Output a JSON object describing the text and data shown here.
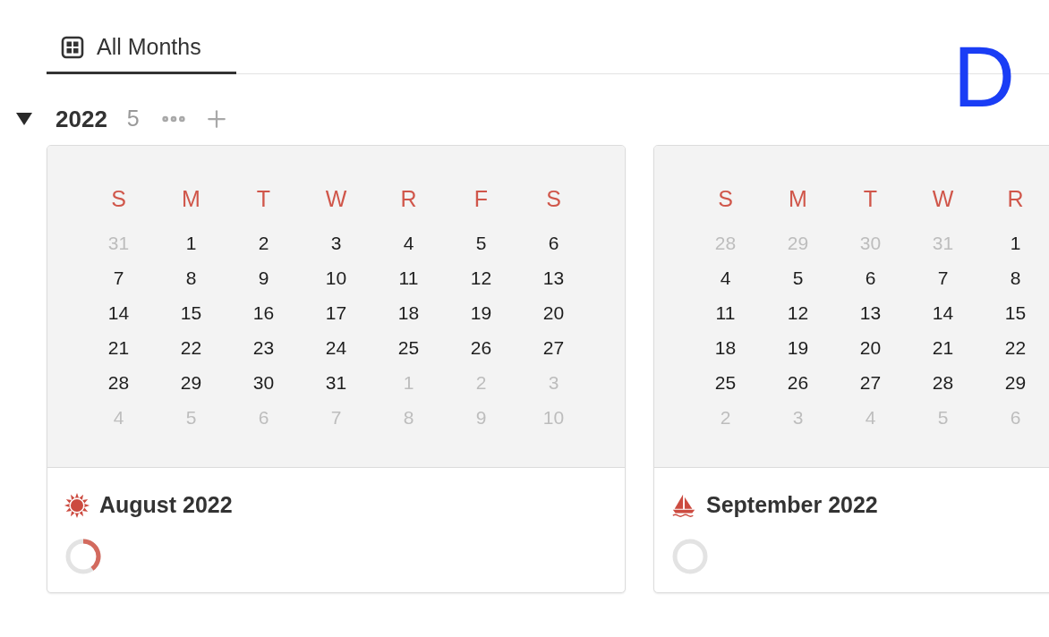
{
  "tabs": [
    {
      "label": "All Months",
      "selected": true
    }
  ],
  "corner_letter": "D",
  "group": {
    "title": "2022",
    "count": "5",
    "expanded": true
  },
  "cards": [
    {
      "title": "August 2022",
      "level": 0.4,
      "weekdays": [
        "S",
        "M",
        "T",
        "W",
        "R",
        "F",
        "S"
      ],
      "weeks": [
        [
          {
            "text": "31",
            "muted": true
          },
          {
            "text": "1",
            "muted": false
          },
          {
            "text": "2",
            "muted": false
          },
          {
            "text": "3",
            "muted": false
          },
          {
            "text": "4",
            "muted": false
          },
          {
            "text": "5",
            "muted": false
          },
          {
            "text": "6",
            "muted": false
          }
        ],
        [
          {
            "text": "7",
            "muted": false
          },
          {
            "text": "8",
            "muted": false
          },
          {
            "text": "9",
            "muted": false
          },
          {
            "text": "10",
            "muted": false
          },
          {
            "text": "11",
            "muted": false
          },
          {
            "text": "12",
            "muted": false
          },
          {
            "text": "13",
            "muted": false
          }
        ],
        [
          {
            "text": "14",
            "muted": false
          },
          {
            "text": "15",
            "muted": false
          },
          {
            "text": "16",
            "muted": false
          },
          {
            "text": "17",
            "muted": false
          },
          {
            "text": "18",
            "muted": false
          },
          {
            "text": "19",
            "muted": false
          },
          {
            "text": "20",
            "muted": false
          }
        ],
        [
          {
            "text": "21",
            "muted": false
          },
          {
            "text": "22",
            "muted": false
          },
          {
            "text": "23",
            "muted": false
          },
          {
            "text": "24",
            "muted": false
          },
          {
            "text": "25",
            "muted": false
          },
          {
            "text": "26",
            "muted": false
          },
          {
            "text": "27",
            "muted": false
          }
        ],
        [
          {
            "text": "28",
            "muted": false
          },
          {
            "text": "29",
            "muted": false
          },
          {
            "text": "30",
            "muted": false
          },
          {
            "text": "31",
            "muted": false
          },
          {
            "text": "1",
            "muted": true
          },
          {
            "text": "2",
            "muted": true
          },
          {
            "text": "3",
            "muted": true
          }
        ],
        [
          {
            "text": "4",
            "muted": true
          },
          {
            "text": "5",
            "muted": true
          },
          {
            "text": "6",
            "muted": true
          },
          {
            "text": "7",
            "muted": true
          },
          {
            "text": "8",
            "muted": true
          },
          {
            "text": "9",
            "muted": true
          },
          {
            "text": "10",
            "muted": true
          }
        ]
      ]
    },
    {
      "title": "September 2022",
      "level": 0,
      "weekdays": [
        "S",
        "M",
        "T",
        "W",
        "R"
      ],
      "weeks": [
        [
          {
            "text": "28",
            "muted": true
          },
          {
            "text": "29",
            "muted": true
          },
          {
            "text": "30",
            "muted": true
          },
          {
            "text": "31",
            "muted": true
          },
          {
            "text": "1",
            "muted": false
          }
        ],
        [
          {
            "text": "4",
            "muted": false
          },
          {
            "text": "5",
            "muted": false
          },
          {
            "text": "6",
            "muted": false
          },
          {
            "text": "7",
            "muted": false
          },
          {
            "text": "8",
            "muted": false
          }
        ],
        [
          {
            "text": "11",
            "muted": false
          },
          {
            "text": "12",
            "muted": false
          },
          {
            "text": "13",
            "muted": false
          },
          {
            "text": "14",
            "muted": false
          },
          {
            "text": "15",
            "muted": false
          }
        ],
        [
          {
            "text": "18",
            "muted": false
          },
          {
            "text": "19",
            "muted": false
          },
          {
            "text": "20",
            "muted": false
          },
          {
            "text": "21",
            "muted": false
          },
          {
            "text": "22",
            "muted": false
          }
        ],
        [
          {
            "text": "25",
            "muted": false
          },
          {
            "text": "26",
            "muted": false
          },
          {
            "text": "27",
            "muted": false
          },
          {
            "text": "28",
            "muted": false
          },
          {
            "text": "29",
            "muted": false
          }
        ],
        [
          {
            "text": "2",
            "muted": true
          },
          {
            "text": "3",
            "muted": true
          },
          {
            "text": "4",
            "muted": true
          },
          {
            "text": "5",
            "muted": true
          },
          {
            "text": "6",
            "muted": true
          }
        ]
      ]
    }
  ]
}
